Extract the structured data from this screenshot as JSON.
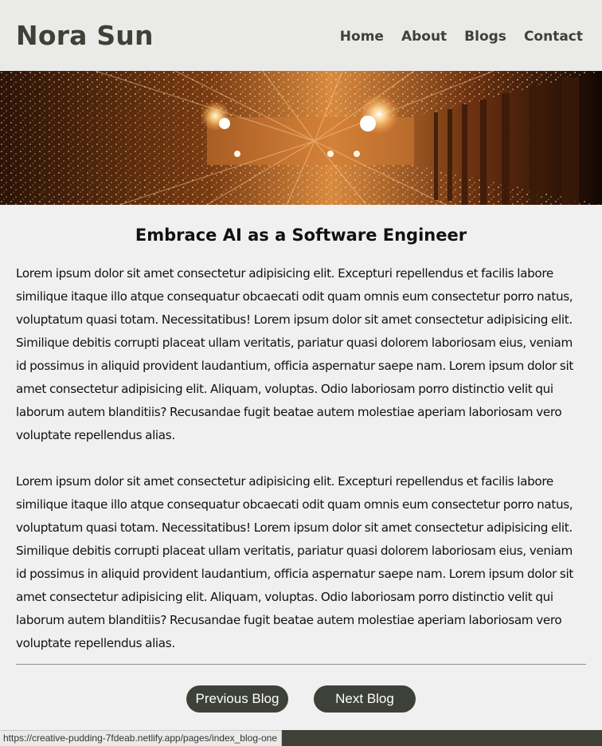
{
  "header": {
    "site_title": "Nora Sun",
    "nav": [
      {
        "label": "Home"
      },
      {
        "label": "About"
      },
      {
        "label": "Blogs"
      },
      {
        "label": "Contact"
      }
    ]
  },
  "hero": {
    "image_subject": "warm light particles in a building hall"
  },
  "post": {
    "title": "Embrace AI as a Software Engineer",
    "paragraphs": [
      "Lorem ipsum dolor sit amet consectetur adipisicing elit. Excepturi repellendus et facilis labore similique itaque illo atque consequatur obcaecati odit quam omnis eum consectetur porro natus, voluptatum quasi totam. Necessitatibus! Lorem ipsum dolor sit amet consectetur adipisicing elit. Similique debitis corrupti placeat ullam veritatis, pariatur quasi dolorem laboriosam eius, veniam id possimus in aliquid provident laudantium, officia aspernatur saepe nam. Lorem ipsum dolor sit amet consectetur adipisicing elit. Aliquam, voluptas. Odio laboriosam porro distinctio velit qui laborum autem blanditiis? Recusandae fugit beatae autem molestiae aperiam laboriosam vero voluptate repellendus alias.",
      "Lorem ipsum dolor sit amet consectetur adipisicing elit. Excepturi repellendus et facilis labore similique itaque illo atque consequatur obcaecati odit quam omnis eum consectetur porro natus, voluptatum quasi totam. Necessitatibus! Lorem ipsum dolor sit amet consectetur adipisicing elit. Similique debitis corrupti placeat ullam veritatis, pariatur quasi dolorem laboriosam eius, veniam id possimus in aliquid provident laudantium, officia aspernatur saepe nam. Lorem ipsum dolor sit amet consectetur adipisicing elit. Aliquam, voluptas. Odio laboriosam porro distinctio velit qui laborum autem blanditiis? Recusandae fugit beatae autem molestiae aperiam laboriosam vero voluptate repellendus alias."
    ]
  },
  "pager": {
    "previous_label": "Previous Blog",
    "next_label": "Next Blog"
  },
  "status_bar": {
    "url": "https://creative-pudding-7fdeab.netlify.app/pages/index_blog-one"
  },
  "colors": {
    "brand_dark": "#3d4138",
    "header_bg": "#eaebe8",
    "page_bg": "#f0f0f0"
  }
}
